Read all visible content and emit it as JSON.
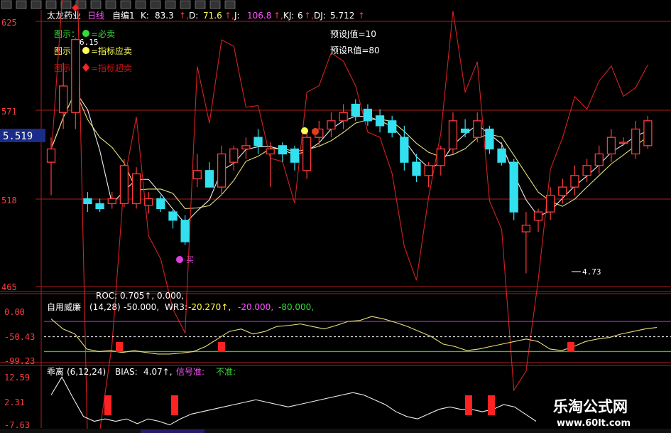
{
  "colors": {
    "up": "#ff3b3b",
    "down": "#33e0f0",
    "axis": "#aa1e1e",
    "yellow": "#ffff55",
    "white": "#ffffff",
    "magenta": "#ff55ff",
    "green": "#33dd33",
    "pink": "#e040e0"
  },
  "toolbar": {
    "icons": [
      "grid-icon",
      "bar-chart-icon",
      "chart-icon",
      "arrow-icon",
      "color-icon",
      "tools-icon",
      "vol-icon",
      "dots-icon",
      "bell-icon",
      "grid2-icon",
      "edit-icon",
      "window-icon",
      "print-icon",
      "save-icon",
      "list-icon",
      "sort-icon"
    ]
  },
  "main": {
    "title": "太龙药业",
    "period": "日线",
    "indicator": "自编1",
    "k_label": "K:",
    "k_val": "83.3",
    "d_label": "D:",
    "d_val": "71.6",
    "j_label": "J:",
    "j_val": "106.8",
    "kj_label": "KJ:",
    "kj_val": "6",
    "dj_label": "DJ:",
    "dj_val": "5.712",
    "legend1_prefix": "图示：",
    "legend1_text": "=必卖",
    "legend2_prefix": "图示：",
    "legend2_text": "=指标应卖",
    "legend3_prefix": "图示：",
    "legend3_text": "=指标超卖",
    "preset_j": "预设J值=10",
    "preset_r": "预设R值=80",
    "price_tag": "5.519",
    "high_label": "6.15",
    "low_label": "4.73",
    "buy_label": "买",
    "y_ticks": [
      "625",
      "571",
      "518",
      "465"
    ]
  },
  "panel2": {
    "roc_line": "ROC: 0.705↑, 0.000,",
    "name": "自用威廉",
    "params": "(14,28)",
    "wr_val": "-50.000,",
    "wr3_label": "WR3:",
    "wr3_val": "-20.270↑,",
    "lvl1": "-20.000,",
    "lvl2": "-80.000,",
    "y_ticks": [
      "0.00",
      "-50.43",
      "-99.23"
    ]
  },
  "panel3": {
    "name": "乖离",
    "params": "(6,12,24)",
    "bias_label": "BIAS:",
    "bias_val": "4.07↑,",
    "sig1": "信号准:",
    "sig2": "不准:",
    "y_ticks": [
      "12.59",
      "2.31",
      "-7.63"
    ]
  },
  "watermark": {
    "title": "乐淘公式网",
    "url": "www.60lt.com"
  },
  "chart_data": [
    {
      "type": "candlestick",
      "title": "太龙药业 日线",
      "ylim": [
        4.65,
        6.25
      ],
      "y_ticks": [
        6.25,
        5.71,
        5.18,
        4.65
      ],
      "current_price": 5.519,
      "annotations": [
        {
          "text": "6.15",
          "kind": "high"
        },
        {
          "text": "4.73",
          "kind": "low"
        },
        {
          "text": "买",
          "kind": "signal"
        }
      ],
      "candles": [
        {
          "o": 5.4,
          "h": 5.55,
          "l": 5.2,
          "c": 5.48
        },
        {
          "o": 5.7,
          "h": 6.0,
          "l": 5.6,
          "c": 5.86
        },
        {
          "o": 5.7,
          "h": 6.15,
          "l": 5.6,
          "c": 6.14
        },
        {
          "o": 5.18,
          "h": 5.22,
          "l": 5.1,
          "c": 5.15
        },
        {
          "o": 5.15,
          "h": 5.18,
          "l": 5.1,
          "c": 5.12
        },
        {
          "o": 5.15,
          "h": 5.22,
          "l": 5.12,
          "c": 5.18
        },
        {
          "o": 5.15,
          "h": 5.42,
          "l": 5.13,
          "c": 5.38
        },
        {
          "o": 5.15,
          "h": 5.37,
          "l": 5.12,
          "c": 5.33
        },
        {
          "o": 5.14,
          "h": 5.22,
          "l": 5.09,
          "c": 5.18
        },
        {
          "o": 5.18,
          "h": 5.2,
          "l": 5.1,
          "c": 5.12
        },
        {
          "o": 5.1,
          "h": 5.12,
          "l": 5.0,
          "c": 5.05
        },
        {
          "o": 5.05,
          "h": 5.08,
          "l": 4.9,
          "c": 4.92
        },
        {
          "o": 5.3,
          "h": 5.45,
          "l": 5.25,
          "c": 5.35
        },
        {
          "o": 5.35,
          "h": 5.4,
          "l": 5.25,
          "c": 5.25
        },
        {
          "o": 5.25,
          "h": 5.5,
          "l": 5.2,
          "c": 5.45
        },
        {
          "o": 5.4,
          "h": 5.5,
          "l": 5.35,
          "c": 5.48
        },
        {
          "o": 5.48,
          "h": 5.55,
          "l": 5.42,
          "c": 5.5
        },
        {
          "o": 5.55,
          "h": 5.6,
          "l": 5.45,
          "c": 5.5
        },
        {
          "o": 5.45,
          "h": 5.52,
          "l": 5.25,
          "c": 5.48
        },
        {
          "o": 5.5,
          "h": 5.52,
          "l": 5.4,
          "c": 5.45
        },
        {
          "o": 5.48,
          "h": 5.5,
          "l": 5.35,
          "c": 5.4
        },
        {
          "o": 5.35,
          "h": 5.6,
          "l": 5.3,
          "c": 5.55
        },
        {
          "o": 5.55,
          "h": 5.65,
          "l": 5.5,
          "c": 5.6
        },
        {
          "o": 5.6,
          "h": 5.7,
          "l": 5.55,
          "c": 5.65
        },
        {
          "o": 5.65,
          "h": 5.75,
          "l": 5.6,
          "c": 5.7
        },
        {
          "o": 5.75,
          "h": 5.78,
          "l": 5.65,
          "c": 5.68
        },
        {
          "o": 5.72,
          "h": 5.75,
          "l": 5.62,
          "c": 5.65
        },
        {
          "o": 5.68,
          "h": 5.72,
          "l": 5.58,
          "c": 5.62
        },
        {
          "o": 5.65,
          "h": 5.68,
          "l": 5.55,
          "c": 5.58
        },
        {
          "o": 5.55,
          "h": 5.62,
          "l": 5.35,
          "c": 5.4
        },
        {
          "o": 5.4,
          "h": 5.45,
          "l": 5.28,
          "c": 5.32
        },
        {
          "o": 5.32,
          "h": 5.4,
          "l": 5.25,
          "c": 5.38
        },
        {
          "o": 5.38,
          "h": 5.5,
          "l": 5.32,
          "c": 5.48
        },
        {
          "o": 5.48,
          "h": 5.7,
          "l": 5.45,
          "c": 5.65
        },
        {
          "o": 5.6,
          "h": 5.66,
          "l": 5.55,
          "c": 5.58
        },
        {
          "o": 5.55,
          "h": 5.7,
          "l": 5.52,
          "c": 5.65
        },
        {
          "o": 5.6,
          "h": 5.62,
          "l": 5.45,
          "c": 5.48
        },
        {
          "o": 5.48,
          "h": 5.52,
          "l": 5.38,
          "c": 5.4
        },
        {
          "o": 5.4,
          "h": 5.42,
          "l": 5.05,
          "c": 5.1
        },
        {
          "o": 4.98,
          "h": 5.1,
          "l": 4.73,
          "c": 5.02
        },
        {
          "o": 5.05,
          "h": 5.12,
          "l": 4.98,
          "c": 5.1
        },
        {
          "o": 5.1,
          "h": 5.25,
          "l": 5.05,
          "c": 5.2
        },
        {
          "o": 5.2,
          "h": 5.3,
          "l": 5.15,
          "c": 5.25
        },
        {
          "o": 5.25,
          "h": 5.38,
          "l": 5.2,
          "c": 5.32
        },
        {
          "o": 5.32,
          "h": 5.42,
          "l": 5.28,
          "c": 5.38
        },
        {
          "o": 5.38,
          "h": 5.5,
          "l": 5.33,
          "c": 5.45
        },
        {
          "o": 5.45,
          "h": 5.6,
          "l": 5.4,
          "c": 5.55
        },
        {
          "o": 5.52,
          "h": 5.55,
          "l": 5.5,
          "c": 5.52
        },
        {
          "o": 5.45,
          "h": 5.65,
          "l": 5.42,
          "c": 5.6
        },
        {
          "o": 5.5,
          "h": 5.68,
          "l": 5.48,
          "c": 5.65
        }
      ]
    },
    {
      "type": "line",
      "title": "自用威廉(14,28)",
      "ylim": [
        -99.23,
        0
      ],
      "y_ticks": [
        0.0,
        -50.43,
        -99.23
      ],
      "reference_lines": [
        -20,
        -80
      ],
      "series": [
        {
          "name": "WR3",
          "values": [
            -15,
            -35,
            -45,
            -75,
            -80,
            -78,
            -82,
            -78,
            -82,
            -85,
            -85,
            -83,
            -80,
            -70,
            -55,
            -40,
            -35,
            -45,
            -40,
            -30,
            -28,
            -25,
            -30,
            -35,
            -28,
            -20,
            -18,
            -10,
            -15,
            -22,
            -30,
            -40,
            -50,
            -65,
            -70,
            -78,
            -75,
            -70,
            -65,
            -60,
            -55,
            -60,
            -75,
            -78,
            -70,
            -60,
            -55,
            -52,
            -45,
            -40,
            -35,
            -32
          ]
        }
      ],
      "signals": [
        9,
        25,
        61
      ]
    },
    {
      "type": "line",
      "title": "乖离(6,12,24)",
      "ylim": [
        -7.63,
        12.59
      ],
      "y_ticks": [
        12.59,
        2.31,
        -7.63
      ],
      "series": [
        {
          "name": "BIAS",
          "values": [
            5,
            12.5,
            4,
            -4,
            -6,
            -5,
            -6,
            -5,
            -7,
            -5,
            -6,
            -7.5,
            -5,
            -3,
            -2,
            -1,
            0,
            1,
            2,
            3,
            2,
            1,
            0,
            1,
            2,
            3,
            4,
            5,
            6,
            5,
            3,
            1,
            -2,
            -4,
            -5,
            -3,
            -1,
            0,
            -1,
            -1,
            -2,
            -1,
            1,
            0,
            -3,
            -6
          ]
        }
      ],
      "signals": [
        9,
        18,
        64,
        67
      ]
    }
  ]
}
